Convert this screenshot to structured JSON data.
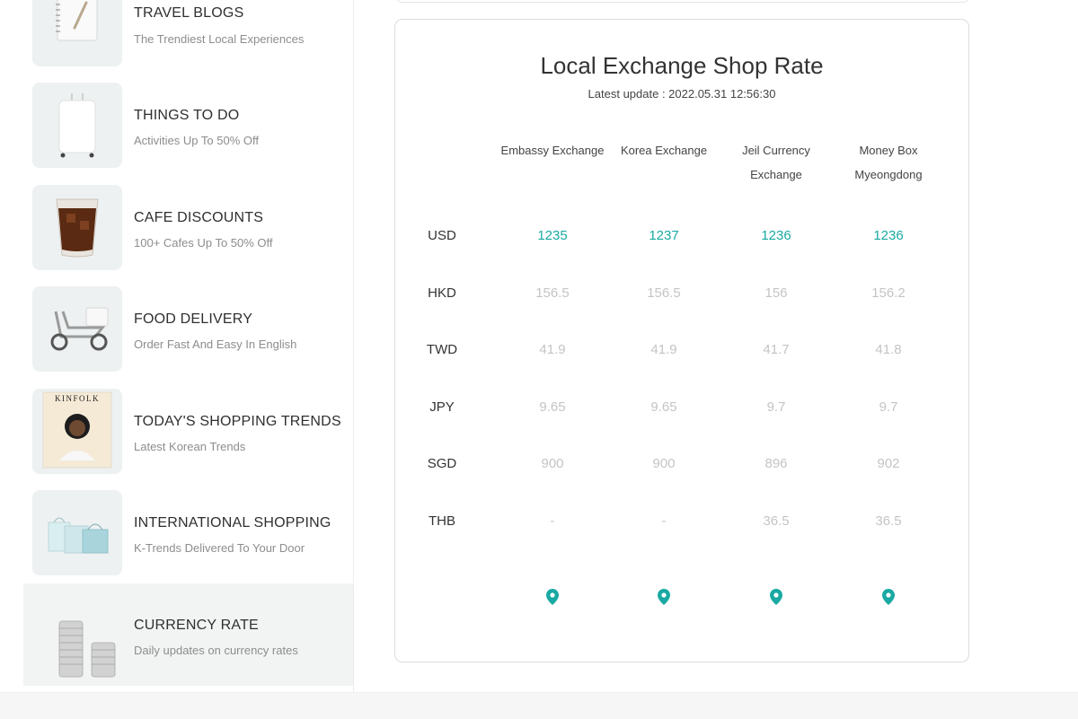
{
  "sidebar": {
    "items": [
      {
        "title": "TRAVEL BLOGS",
        "subtitle": "The Trendiest Local Experiences",
        "icon": "notebook-icon"
      },
      {
        "title": "THINGS TO DO",
        "subtitle": "Activities Up To 50% Off",
        "icon": "suitcase-icon"
      },
      {
        "title": "CAFE DISCOUNTS",
        "subtitle": "100+ Cafes Up To 50% Off",
        "icon": "iced-coffee-icon"
      },
      {
        "title": "FOOD DELIVERY",
        "subtitle": "Order Fast And Easy In English",
        "icon": "scooter-icon"
      },
      {
        "title": "TODAY'S SHOPPING TRENDS",
        "subtitle": "Latest Korean Trends",
        "icon": "magazine-icon",
        "image_text": "KINFOLK"
      },
      {
        "title": "INTERNATIONAL SHOPPING",
        "subtitle": "K-Trends Delivered To Your Door",
        "icon": "shopping-bags-icon"
      },
      {
        "title": "CURRENCY RATE",
        "subtitle": "Daily updates on currency rates",
        "icon": "coin-stack-icon"
      }
    ]
  },
  "rate_card": {
    "title": "Local Exchange Shop Rate",
    "update": "Latest update : 2022.05.31 12:56:30",
    "columns": [
      {
        "line1": "Embassy Exchange",
        "line2": ""
      },
      {
        "line1": "Korea Exchange",
        "line2": ""
      },
      {
        "line1": "Jeil Currency",
        "line2": "Exchange"
      },
      {
        "line1": "Money Box",
        "line2": "Myeongdong"
      }
    ],
    "rows": [
      {
        "code": "USD",
        "values": [
          "1235",
          "1237",
          "1236",
          "1236"
        ]
      },
      {
        "code": "HKD",
        "values": [
          "156.5",
          "156.5",
          "156",
          "156.2"
        ]
      },
      {
        "code": "TWD",
        "values": [
          "41.9",
          "41.9",
          "41.7",
          "41.8"
        ]
      },
      {
        "code": "JPY",
        "values": [
          "9.65",
          "9.65",
          "9.7",
          "9.7"
        ]
      },
      {
        "code": "SGD",
        "values": [
          "900",
          "900",
          "896",
          "902"
        ]
      },
      {
        "code": "THB",
        "values": [
          "-",
          "-",
          "36.5",
          "36.5"
        ]
      }
    ],
    "pin_icon": "map-pin-icon"
  },
  "colors": {
    "accent": "#1aa9a2",
    "muted": "#c4c4c4",
    "active_bg": "#f2f4f4"
  }
}
